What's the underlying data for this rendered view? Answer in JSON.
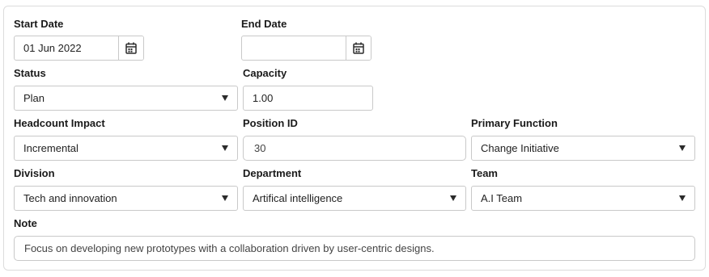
{
  "form": {
    "start_date": {
      "label": "Start Date",
      "value": "01 Jun 2022"
    },
    "end_date": {
      "label": "End Date",
      "value": ""
    },
    "status": {
      "label": "Status",
      "value": "Plan"
    },
    "capacity": {
      "label": "Capacity",
      "value": "1.00"
    },
    "headcount_impact": {
      "label": "Headcount Impact",
      "value": "Incremental"
    },
    "position_id": {
      "label": "Position ID",
      "value": "30"
    },
    "primary_function": {
      "label": "Primary Function",
      "value": "Change Initiative"
    },
    "division": {
      "label": "Division",
      "value": "Tech and innovation"
    },
    "department": {
      "label": "Department",
      "value": "Artifical intelligence"
    },
    "team": {
      "label": "Team",
      "value": "A.I Team"
    },
    "note": {
      "label": "Note",
      "value": "Focus on developing new prototypes with a collaboration driven by user-centric designs."
    }
  },
  "icons": {
    "calendar": "calendar-icon",
    "dropdown": "chevron-down-icon"
  }
}
